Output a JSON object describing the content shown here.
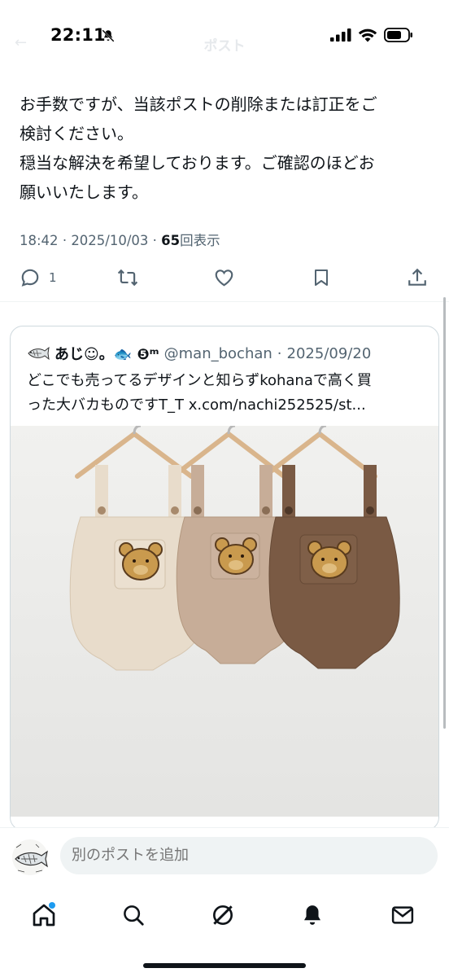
{
  "status_bar": {
    "time": "22:11"
  },
  "header": {
    "title": "ポスト"
  },
  "post": {
    "lines": [
      "お手数ですが、当該ポストの削除または訂正をご",
      "検討ください。",
      "穏当な解決を希望しております。ご確認のほどお",
      "願いいたします。"
    ],
    "time": "18:42",
    "date": "2025/10/03",
    "views_count": "65",
    "views_label": "回表示",
    "separator": "·",
    "reply_count": "1"
  },
  "quoted_post": {
    "display_name": "あじ☺︎。🐟 ❺ᵐ",
    "handle": "@man_bochan",
    "separator": "·",
    "date": "2025/09/20",
    "text_lines": [
      "どこでも売ってるデザインと知らずkohanaで高く買",
      "った大バカものですT_T x.com/nachi252525/st..."
    ]
  },
  "composer": {
    "placeholder": "別のポストを追加"
  },
  "colors": {
    "text": "#0f1419",
    "secondary": "#536471",
    "border": "#cfd9de",
    "accent": "#1d9bf0",
    "romper_cream": "#e8dccb",
    "romper_beige": "#c7ad98",
    "romper_brown": "#7a5a44"
  },
  "icons": {
    "nav": [
      "home-icon",
      "search-icon",
      "grok-icon",
      "notifications-icon",
      "messages-icon"
    ],
    "actions": [
      "reply-icon",
      "repost-icon",
      "like-icon",
      "bookmark-icon",
      "share-icon"
    ]
  }
}
